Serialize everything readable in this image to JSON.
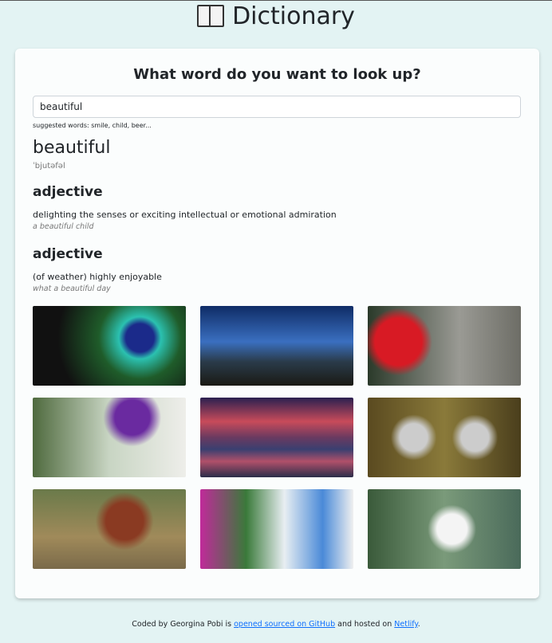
{
  "header": {
    "title": "Dictionary",
    "icon": "open-book-icon"
  },
  "search": {
    "heading": "What word do you want to look up?",
    "value": "beautiful",
    "hint": "suggested words: smile, child, beer..."
  },
  "result": {
    "word": "beautiful",
    "phonetic": "ˈbjutəfəl",
    "meanings": [
      {
        "part_of_speech": "adjective",
        "definition": "delighting the senses or exciting intellectual or emotional admiration",
        "example": "a beautiful child"
      },
      {
        "part_of_speech": "adjective",
        "definition": "(of weather) highly enjoyable",
        "example": "what a beautiful day"
      }
    ]
  },
  "photos": [
    "peacock feather",
    "butterflies and mushrooms",
    "red hibiscus and hummingbird",
    "purple flowers in vase",
    "mountain lake at sunset",
    "crowned cranes",
    "woman with tulips",
    "flowers by white house",
    "woman with flowers"
  ],
  "footer": {
    "text1": "Coded by Georgina Pobi is ",
    "link1": "opened sourced on GitHub",
    "text2": " and hosted on ",
    "link2": "Netlify",
    "text3": ".",
    "link_color": "#0d6efd"
  }
}
